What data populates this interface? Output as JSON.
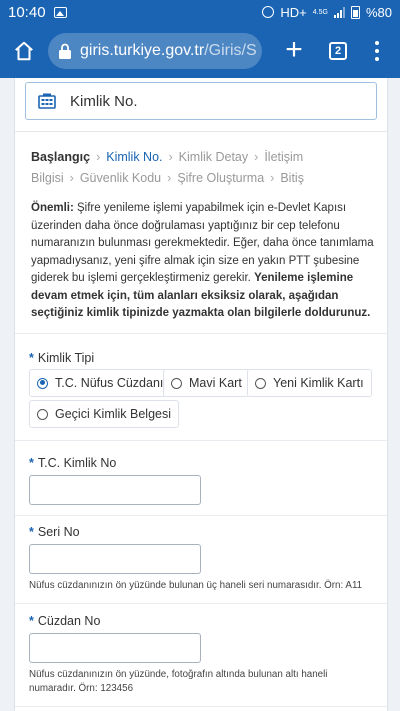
{
  "status_bar": {
    "time": "10:40",
    "network": "HD+",
    "network_type": "4.5G",
    "battery": "%80"
  },
  "browser": {
    "url_domain": "giris.turkiye.gov.tr",
    "url_path": "/Giris/S",
    "tab_count": "2"
  },
  "header": {
    "title": "Kimlik No."
  },
  "steps": {
    "s1": "Başlangıç",
    "s2": "Kimlik No.",
    "s3": "Kimlik Detay",
    "s4": "İletişim Bilgisi",
    "s5": "Güvenlik Kodu",
    "s6": "Şifre Oluşturma",
    "s7": "Bitiş"
  },
  "info": {
    "label": "Önemli:",
    "text": " Şifre yenileme işlemi yapabilmek için e-Devlet Kapısı üzerinden daha önce doğrulaması yaptığınız bir cep telefonu numaranızın bulunması gerekmektedir. Eğer, daha önce tanımlama yapmadıysanız, yeni şifre almak için size en yakın PTT şubesine giderek bu işlemi gerçekleştirmeniz gerekir. ",
    "bold": "Yenileme işlemine devam etmek için, tüm alanları eksiksiz olarak, aşağıdan seçtiğiniz kimlik tipinizde yazmakta olan bilgilerle doldurunuz."
  },
  "form": {
    "required_mark": "*",
    "kimlik_tipi": {
      "label": "Kimlik Tipi",
      "options": [
        "T.C. Nüfus Cüzdanı",
        "Mavi Kart",
        "Yeni Kimlik Kartı",
        "Geçici Kimlik Belgesi"
      ],
      "selected": "T.C. Nüfus Cüzdanı"
    },
    "tc_kimlik_no": {
      "label": "T.C. Kimlik No",
      "value": ""
    },
    "seri_no": {
      "label": "Seri No",
      "value": "",
      "help": "Nüfus cüzdanınızın ön yüzünde bulunan üç haneli seri numarasıdır. Örn: A11"
    },
    "cuzdan_no": {
      "label": "Cüzdan No",
      "value": "",
      "help": "Nüfus cüzdanınızın ön yüzünde, fotoğrafın altında bulunan altı haneli numaradır. Örn: 123456"
    }
  },
  "colors": {
    "brand": "#1a64b3",
    "background": "#eef1f5"
  },
  "icons": {
    "header": "id-card-icon",
    "home": "home-icon",
    "lock": "lock-icon"
  }
}
